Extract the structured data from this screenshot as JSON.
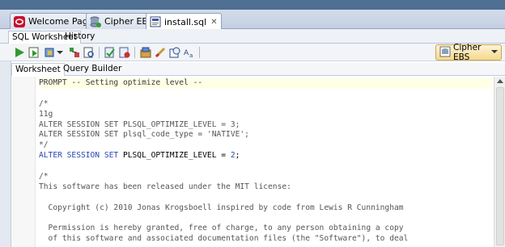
{
  "editor_tabs": [
    {
      "label": "Welcome Page",
      "icon": "oracle-icon"
    },
    {
      "label": "Cipher EBS",
      "icon": "database-connection-icon"
    },
    {
      "label": "install.sql",
      "icon": "sql-file-icon"
    }
  ],
  "sub_tabs": [
    "SQL Worksheet",
    "History"
  ],
  "connection": {
    "label": "Cipher EBS"
  },
  "worksheet_tabs": [
    "Worksheet",
    "Query Builder"
  ],
  "code_lines": [
    {
      "parts": [
        {
          "t": "PROMPT -- Setting optimize level --",
          "c": "str"
        }
      ],
      "hl": true
    },
    {
      "parts": [
        {
          "t": "",
          "c": "str"
        }
      ]
    },
    {
      "parts": [
        {
          "t": "/*",
          "c": "cm"
        }
      ]
    },
    {
      "parts": [
        {
          "t": "11g",
          "c": "cm"
        }
      ]
    },
    {
      "parts": [
        {
          "t": "ALTER SESSION SET PLSQL_OPTIMIZE_LEVEL = 3;",
          "c": "cm"
        }
      ]
    },
    {
      "parts": [
        {
          "t": "ALTER SESSION SET plsql_code_type = 'NATIVE';",
          "c": "cm"
        }
      ]
    },
    {
      "parts": [
        {
          "t": "*/",
          "c": "cm"
        }
      ]
    },
    {
      "parts": [
        {
          "t": "ALTER SESSION SET ",
          "c": "kw"
        },
        {
          "t": "PLSQL_OPTIMIZE_LEVEL = ",
          "c": "plain"
        },
        {
          "t": "2",
          "c": "kw"
        },
        {
          "t": ";",
          "c": "plain"
        }
      ]
    },
    {
      "parts": [
        {
          "t": "",
          "c": "str"
        }
      ]
    },
    {
      "parts": [
        {
          "t": "/*",
          "c": "cm"
        }
      ]
    },
    {
      "parts": [
        {
          "t": "This software has been released under the MIT license:",
          "c": "cm"
        }
      ]
    },
    {
      "parts": [
        {
          "t": "",
          "c": "str"
        }
      ]
    },
    {
      "parts": [
        {
          "t": "  Copyright (c) 2010 Jonas Krogsboell inspired by code from Lewis R Cunningham",
          "c": "cm"
        }
      ]
    },
    {
      "parts": [
        {
          "t": "",
          "c": "str"
        }
      ]
    },
    {
      "parts": [
        {
          "t": "  Permission is hereby granted, free of charge, to any person obtaining a copy",
          "c": "cm"
        }
      ]
    },
    {
      "parts": [
        {
          "t": "  of this software and associated documentation files (the \"Software\"), to deal",
          "c": "cm"
        }
      ]
    }
  ]
}
